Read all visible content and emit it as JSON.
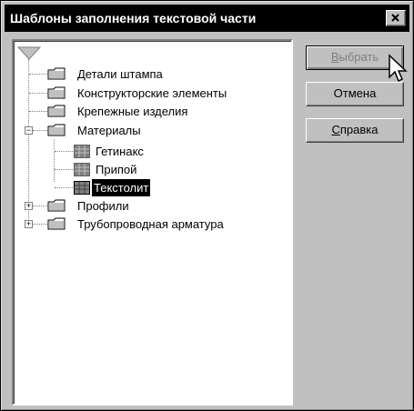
{
  "window": {
    "title": "Шаблоны заполнения текстовой части"
  },
  "tree": {
    "items": [
      {
        "label": "Детали штампа",
        "icon": "folder-icon"
      },
      {
        "label": "Конструкторские элементы",
        "icon": "folder-icon"
      },
      {
        "label": "Крепежные изделия",
        "icon": "folder-icon"
      },
      {
        "label": "Материалы",
        "icon": "folder-open-icon",
        "expanded": true
      },
      {
        "label": "Гетинакс",
        "icon": "table-icon"
      },
      {
        "label": "Припой",
        "icon": "table-icon"
      },
      {
        "label": "Текстолит",
        "icon": "table-icon",
        "selected": true
      },
      {
        "label": "Профили",
        "icon": "folder-icon",
        "expanded": false
      },
      {
        "label": "Трубопроводная арматура",
        "icon": "folder-icon",
        "expanded": false
      }
    ]
  },
  "buttons": {
    "select": {
      "pre": "",
      "accel": "В",
      "post": "ыбрать",
      "enabled": false
    },
    "cancel": {
      "label": "Отмена"
    },
    "help": {
      "pre": "",
      "accel": "С",
      "post": "правка"
    }
  },
  "colors": {
    "face": "#c0c0c0",
    "title_bg": "#000000",
    "selection": "#000000",
    "table_icon": "#808080"
  }
}
